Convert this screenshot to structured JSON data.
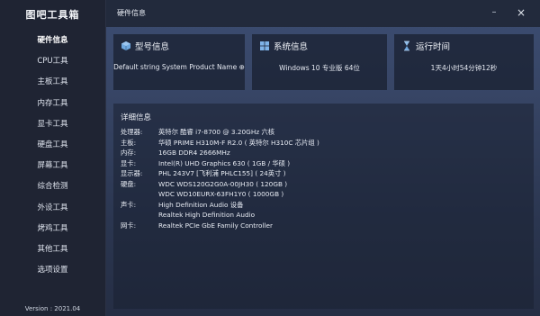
{
  "app": {
    "title": "图吧工具箱",
    "version": "Version : 2021.04"
  },
  "sidebar": {
    "items": [
      {
        "label": "硬件信息"
      },
      {
        "label": "CPU工具"
      },
      {
        "label": "主板工具"
      },
      {
        "label": "内存工具"
      },
      {
        "label": "显卡工具"
      },
      {
        "label": "硬盘工具"
      },
      {
        "label": "屏幕工具"
      },
      {
        "label": "综合检测"
      },
      {
        "label": "外设工具"
      },
      {
        "label": "烤鸡工具"
      },
      {
        "label": "其他工具"
      },
      {
        "label": "选项设置"
      }
    ]
  },
  "window": {
    "title": "硬件信息",
    "minimize": "–",
    "close": "×"
  },
  "cards": {
    "model": {
      "label": "型号信息",
      "value": "Default string System Product Name ⊕",
      "icon": "cube-icon"
    },
    "system": {
      "label": "系统信息",
      "value": "Windows 10 专业版 64位",
      "icon": "windows-icon"
    },
    "uptime": {
      "label": "运行时间",
      "value": "1天4小时54分钟12秒",
      "icon": "hourglass-icon"
    }
  },
  "detail": {
    "title": "详细信息",
    "rows": [
      {
        "key": "处理器:",
        "value": "英特尔 酷睿 i7-8700 @ 3.20GHz 六核"
      },
      {
        "key": "主板:",
        "value": "华硕 PRIME H310M-F R2.0 ( 英特尔 H310C 芯片组 )"
      },
      {
        "key": "内存:",
        "value": "16GB DDR4 2666MHz"
      },
      {
        "key": "显卡:",
        "value": "Intel(R) UHD Graphics 630 ( 1GB / 华硕 )"
      },
      {
        "key": "显示器:",
        "value": "PHL 243V7 [飞利浦 PHLC155] ( 24英寸 )"
      },
      {
        "key": "硬盘:",
        "value": "WDC WDS120G2G0A-00JH30 ( 120GB )"
      },
      {
        "key": "",
        "value": "WDC WD10EURX-63FH1Y0 ( 1000GB )"
      },
      {
        "key": "声卡:",
        "value": "High Definition Audio 设备"
      },
      {
        "key": "",
        "value": "Realtek High Definition Audio"
      },
      {
        "key": "网卡:",
        "value": "Realtek PCIe GbE Family Controller"
      }
    ]
  },
  "colors": {
    "sidebar_bg": "#1f2433",
    "card_bg": "#171e2e",
    "accent_icon": "#7fb3e8"
  }
}
